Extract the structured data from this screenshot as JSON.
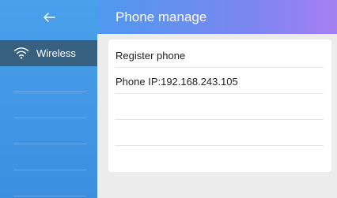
{
  "window": {
    "title": "Phone manage"
  },
  "nav": {
    "back_label": "←",
    "items": [
      {
        "label": "Wireless",
        "icon": "wifi-icon",
        "active": true
      },
      {
        "label": ""
      },
      {
        "label": ""
      },
      {
        "label": ""
      },
      {
        "label": ""
      },
      {
        "label": ""
      }
    ]
  },
  "panel": {
    "rows": [
      {
        "text": "Register phone"
      },
      {
        "text": "Phone IP:192.168.243.105"
      },
      {
        "text": ""
      },
      {
        "text": ""
      }
    ]
  },
  "colors": {
    "sidebar": "#4599e6",
    "sidebar_active": "#375f80",
    "header_start": "#4f99ef",
    "header_end": "#a67ff1",
    "panel": "#ffffff",
    "background": "#ececec"
  }
}
